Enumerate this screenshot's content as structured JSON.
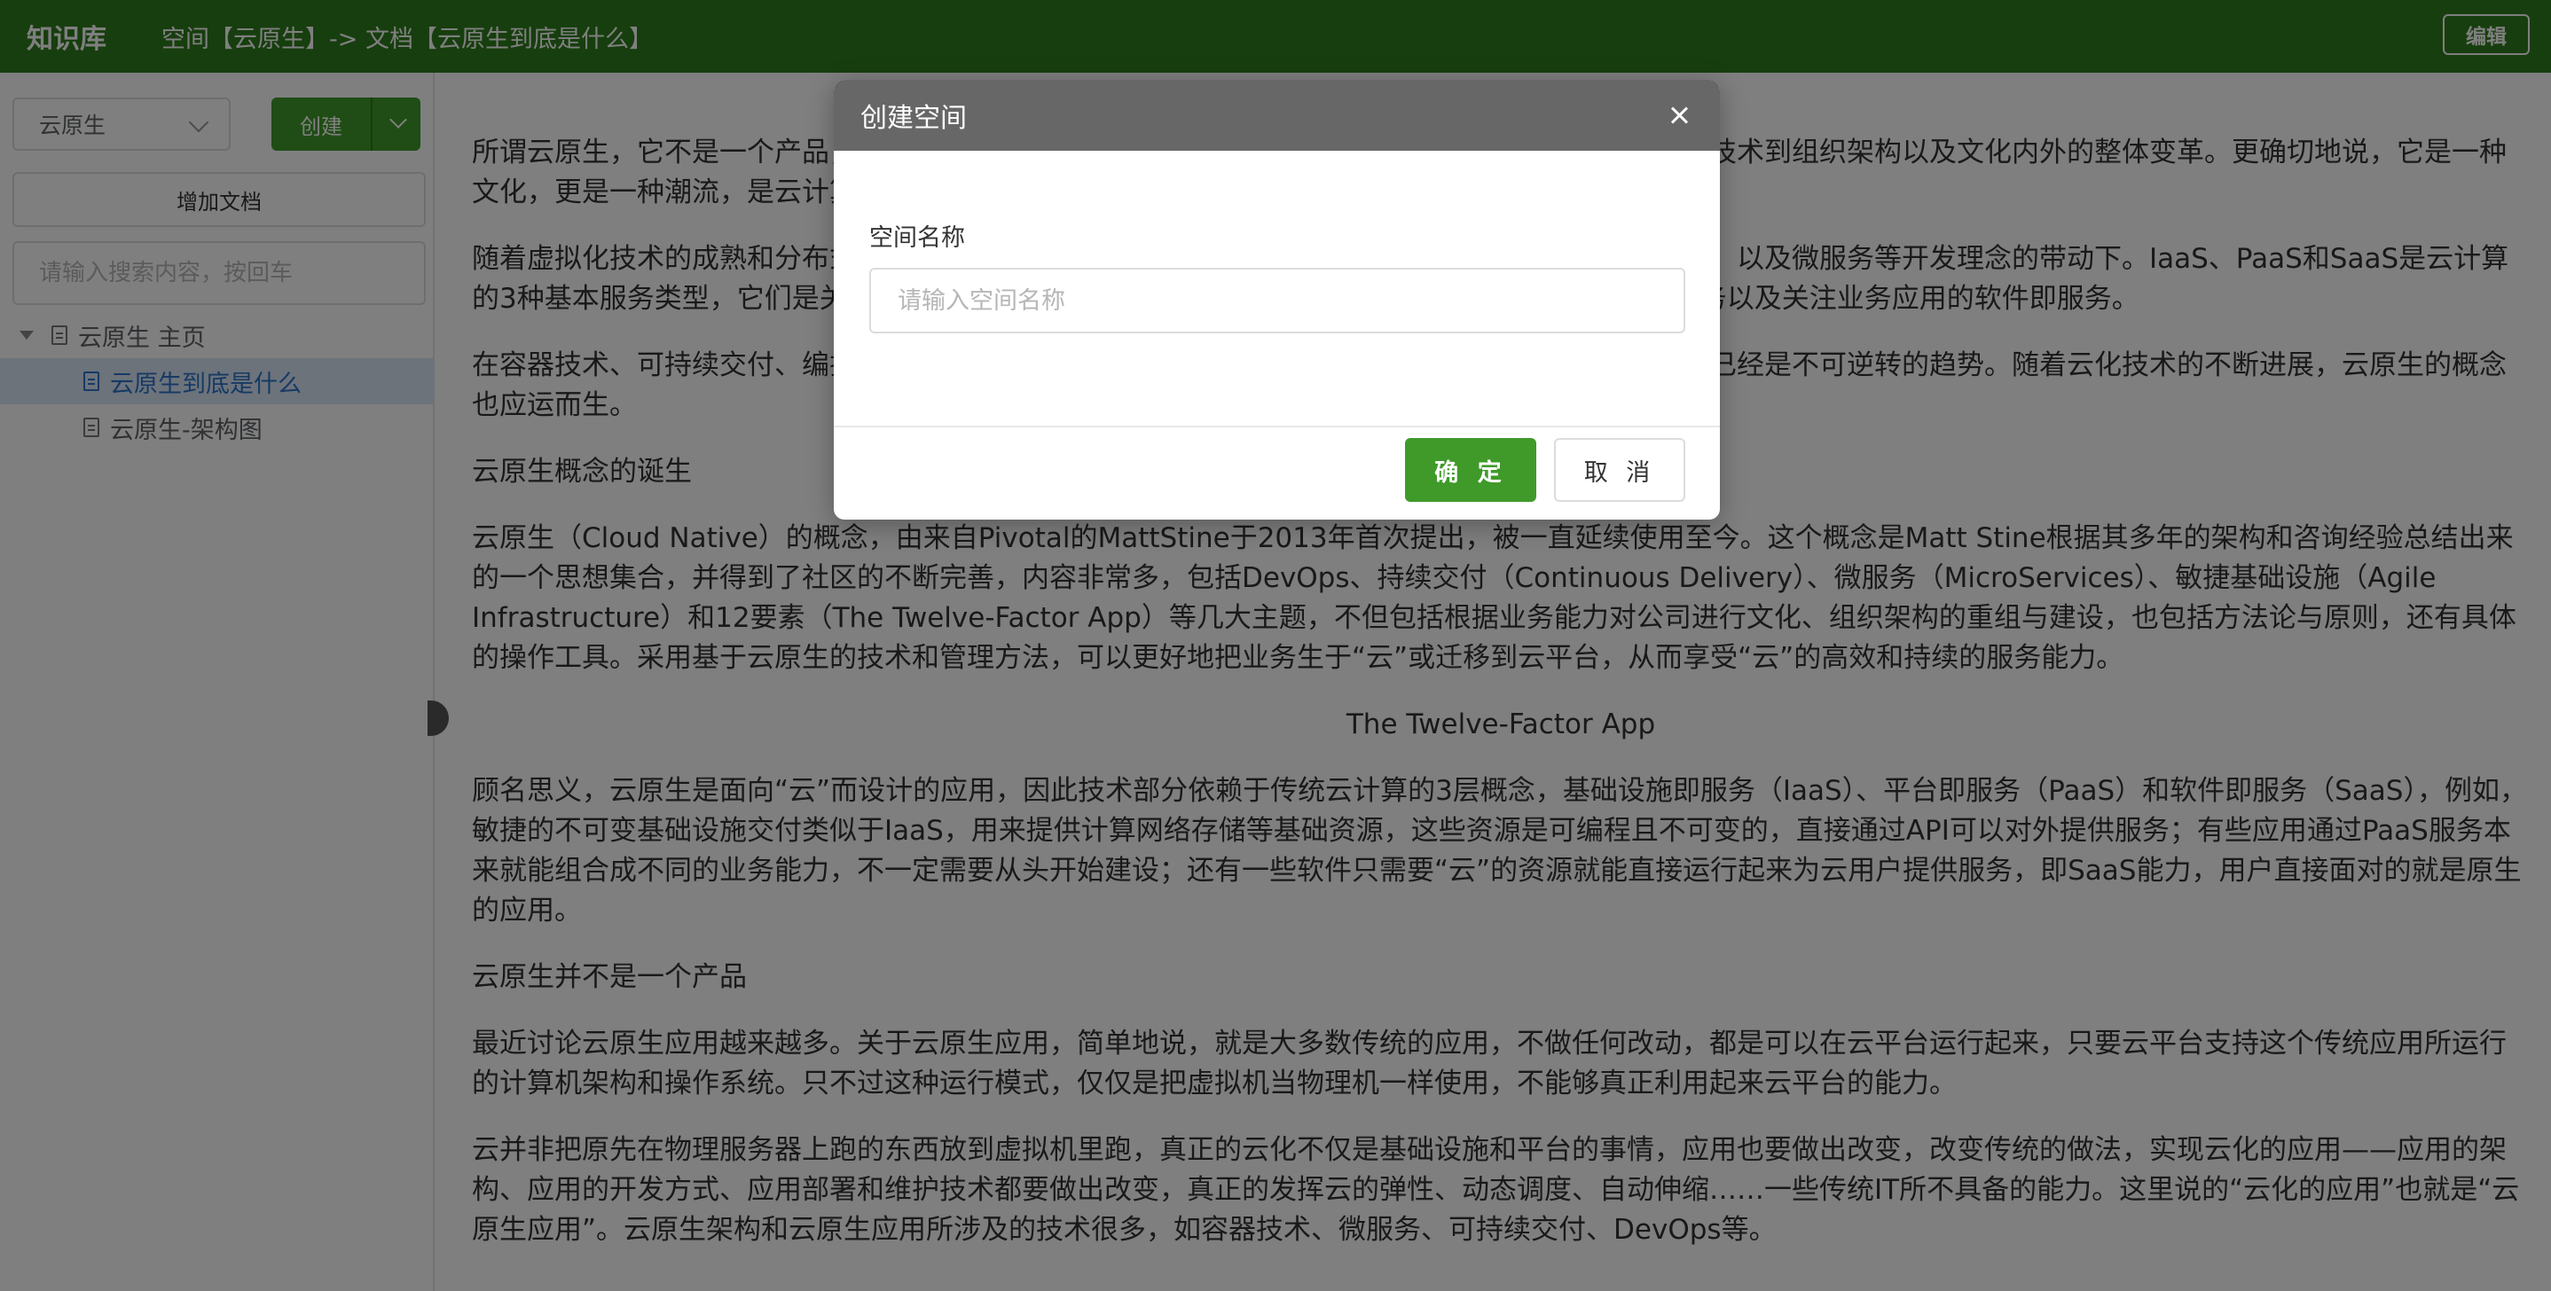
{
  "header": {
    "logo": "知识库",
    "breadcrumb": "空间【云原生】-> 文档【云原生到底是什么】",
    "edit_label": "编辑"
  },
  "sidebar": {
    "space_select": "云原生",
    "create_label": "创建",
    "add_doc_label": "增加文档",
    "search_placeholder": "请输入搜索内容，按回车",
    "tree": [
      {
        "label": "云原生 主页",
        "selected": false
      },
      {
        "label": "云原生到底是什么",
        "selected": true
      },
      {
        "label": "云原生-架构图",
        "selected": false
      }
    ]
  },
  "content": {
    "paragraphs": [
      "所谓云原生，它不是一个产品，而是一套技术体系和一套方法论，它是一种对云计算的使用方式，是从技术到组织架构以及文化内外的整体变革。更确切地说，它是一种文化，更是一种潮流，是云计算的一个必然导向。",
      "随着虚拟化技术的成熟和分布式框架的普及，在容器技术、可持续交付、编排系统等开源社区的推动下，以及微服务等开发理念的带动下。IaaS、PaaS和SaaS是云计算的3种基本服务类型，它们是关注硬件基础设施的基础设施即服务、关注软件和中间件平台的平台即服务以及关注业务应用的软件即服务。",
      "在容器技术、可持续交付、编排系统等开源社区的推动下，以及微服务等开发理念的带动下，应用上云已经是不可逆转的趋势。随着云化技术的不断进展，云原生的概念也应运而生。",
      "云原生概念的诞生",
      "云原生（Cloud Native）的概念，由来自Pivotal的MattStine于2013年首次提出，被一直延续使用至今。这个概念是Matt Stine根据其多年的架构和咨询经验总结出来的一个思想集合，并得到了社区的不断完善，内容非常多，包括DevOps、持续交付（Continuous Delivery）、微服务（MicroServices）、敏捷基础设施（Agile Infrastructure）和12要素（The Twelve-Factor App）等几大主题，不但包括根据业务能力对公司进行文化、组织架构的重组与建设，也包括方法论与原则，还有具体的操作工具。采用基于云原生的技术和管理方法，可以更好地把业务生于“云”或迁移到云平台，从而享受“云”的高效和持续的服务能力。",
      "The Twelve-Factor App",
      "顾名思义，云原生是面向“云”而设计的应用，因此技术部分依赖于传统云计算的3层概念，基础设施即服务（IaaS）、平台即服务（PaaS）和软件即服务（SaaS），例如，敏捷的不可变基础设施交付类似于IaaS，用来提供计算网络存储等基础资源，这些资源是可编程且不可变的，直接通过API可以对外提供服务；有些应用通过PaaS服务本来就能组合成不同的业务能力，不一定需要从头开始建设；还有一些软件只需要“云”的资源就能直接运行起来为云用户提供服务，即SaaS能力，用户直接面对的就是原生的应用。",
      "云原生并不是一个产品",
      "最近讨论云原生应用越来越多。关于云原生应用，简单地说，就是大多数传统的应用，不做任何改动，都是可以在云平台运行起来，只要云平台支持这个传统应用所运行的计算机架构和操作系统。只不过这种运行模式，仅仅是把虚拟机当物理机一样使用，不能够真正利用起来云平台的能力。",
      "云并非把原先在物理服务器上跑的东西放到虚拟机里跑，真正的云化不仅是基础设施和平台的事情，应用也要做出改变，改变传统的做法，实现云化的应用——应用的架构、应用的开发方式、应用部署和维护技术都要做出改变，真正的发挥云的弹性、动态调度、自动伸缩……一些传统IT所不具备的能力。这里说的“云化的应用”也就是“云原生应用”。云原生架构和云原生应用所涉及的技术很多，如容器技术、微服务、可持续交付、DevOps等。"
    ]
  },
  "modal": {
    "title": "创建空间",
    "field_label": "空间名称",
    "field_placeholder": "请输入空间名称",
    "field_value": "",
    "ok_label": "确 定",
    "cancel_label": "取 消"
  },
  "colors": {
    "brand_green": "#2e7d1c",
    "button_green": "#3f9a2a",
    "modal_header": "#676767",
    "selected_bg": "#d9e6f7",
    "selected_text": "#2e74c9"
  }
}
